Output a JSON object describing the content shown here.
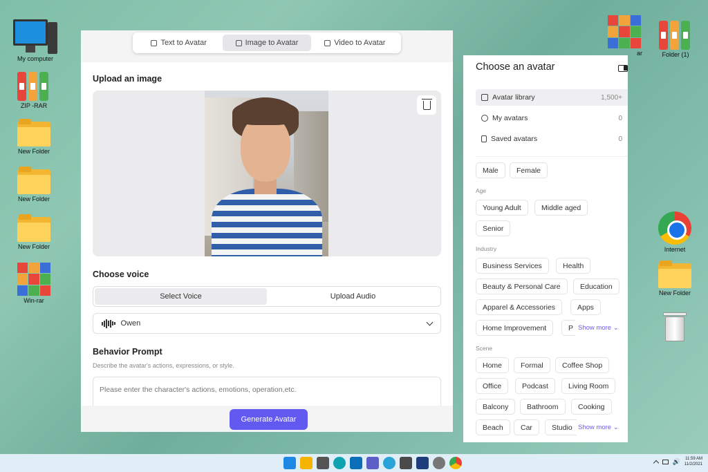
{
  "desktop": {
    "icons_left": [
      {
        "label": "My computer"
      },
      {
        "label": "ZIP -RAR"
      },
      {
        "label": "New Folder"
      },
      {
        "label": "New Folder"
      },
      {
        "label": "New Folder"
      },
      {
        "label": "Win-rar"
      }
    ],
    "icons_right": [
      {
        "label": "ar"
      },
      {
        "label": "Folder (1)"
      },
      {
        "label": "Internet"
      },
      {
        "label": "New Folder"
      }
    ]
  },
  "app": {
    "tabs": [
      {
        "label": "Text to Avatar",
        "icon": "text-icon"
      },
      {
        "label": "Image to Avatar",
        "icon": "image-icon",
        "active": true
      },
      {
        "label": "Video to Avatar",
        "icon": "video-icon"
      }
    ],
    "upload_title": "Upload an image",
    "voice_title": "Choose voice",
    "voice_options": {
      "select": "Select Voice",
      "upload": "Upload Audio"
    },
    "selected_voice": "Owen",
    "behavior_title": "Behavior Prompt",
    "behavior_hint": "Describe the avatar's actions, expressions, or style.",
    "behavior_placeholder": "Please enter the character's actions, emotions, operation,etc.",
    "generate_label": "Generate Avatar",
    "accent": "#6259f0"
  },
  "panel": {
    "title": "Choose an avatar",
    "library": [
      {
        "label": "Avatar library",
        "count": "1,500+"
      },
      {
        "label": "My avatars",
        "count": "0"
      },
      {
        "label": "Saved avatars",
        "count": "0"
      }
    ],
    "gender": [
      "Male",
      "Female"
    ],
    "age_label": "Age",
    "age": [
      "Young Adult",
      "Middle aged",
      "Senior"
    ],
    "industry_label": "Industry",
    "industry": [
      "Business Services",
      "Health",
      "Beauty & Personal Care",
      "Education",
      "Apparel & Accessories",
      "Apps",
      "Home Improvement",
      "P"
    ],
    "scene_label": "Scene",
    "scene": [
      "Home",
      "Formal",
      "Coffee Shop",
      "Office",
      "Podcast",
      "Living Room",
      "Balcony",
      "Bathroom",
      "Cooking",
      "Beach",
      "Car",
      "Studio"
    ],
    "show_more": "Show more"
  },
  "taskbar": {
    "time": "11:59 AM",
    "date": "11/2/2021"
  }
}
